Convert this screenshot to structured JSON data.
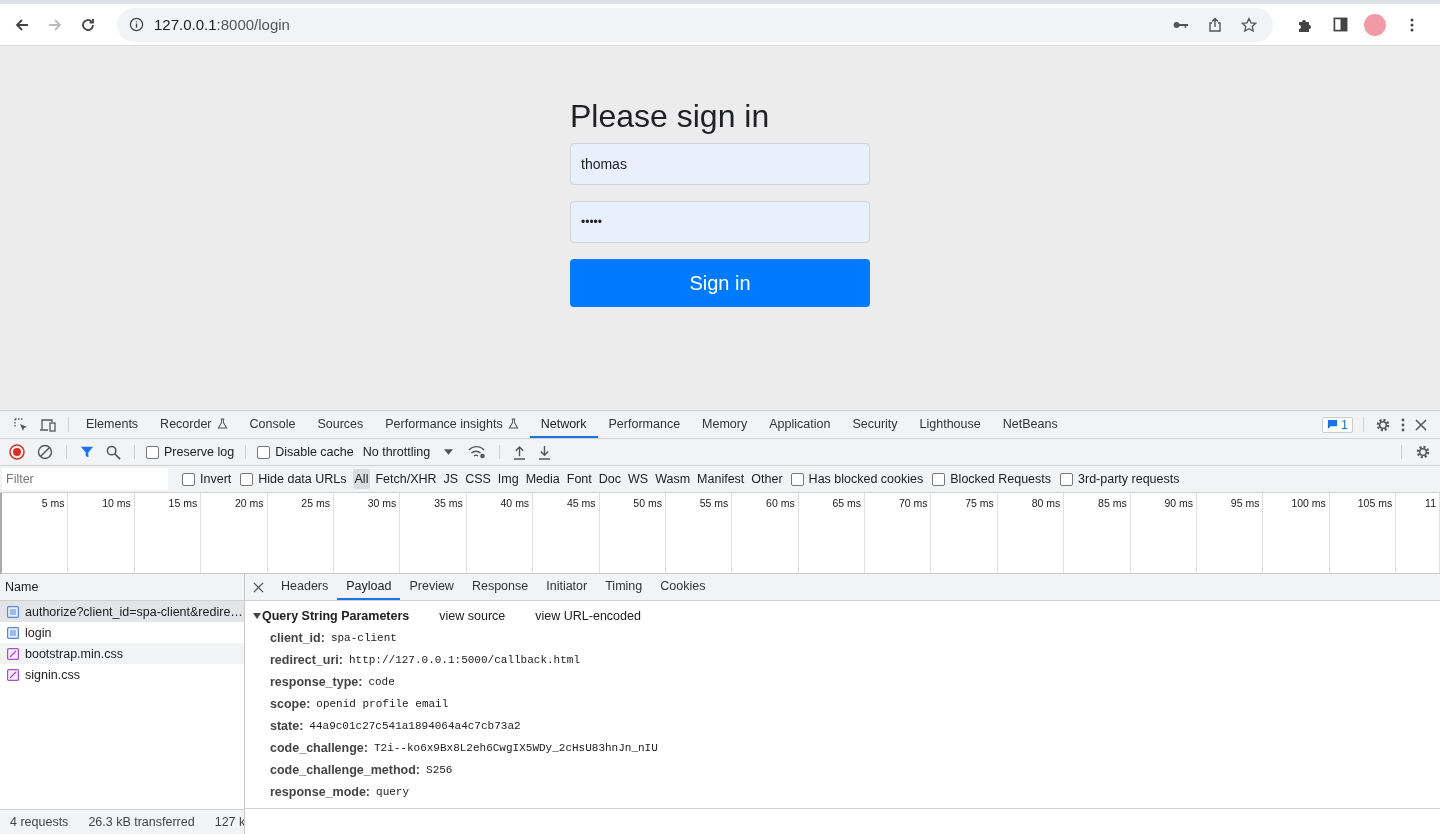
{
  "browser": {
    "navigation": [
      {
        "kind": "back",
        "disabled": false
      },
      {
        "kind": "forward",
        "disabled": true
      },
      {
        "kind": "reload",
        "disabled": false
      }
    ],
    "url_host": "127.0.0.1",
    "url_rest": ":8000/login"
  },
  "page": {
    "heading": "Please sign in",
    "username": "thomas",
    "password": "•••••",
    "button": "Sign in"
  },
  "devtools": {
    "tabs": [
      {
        "label": "Elements",
        "selected": false,
        "experimental": false
      },
      {
        "label": "Recorder",
        "selected": false,
        "experimental": true
      },
      {
        "label": "Console",
        "selected": false,
        "experimental": false
      },
      {
        "label": "Sources",
        "selected": false,
        "experimental": false
      },
      {
        "label": "Performance insights",
        "selected": false,
        "experimental": true
      },
      {
        "label": "Network",
        "selected": true,
        "experimental": false
      },
      {
        "label": "Performance",
        "selected": false,
        "experimental": false
      },
      {
        "label": "Memory",
        "selected": false,
        "experimental": false
      },
      {
        "label": "Application",
        "selected": false,
        "experimental": false
      },
      {
        "label": "Security",
        "selected": false,
        "experimental": false
      },
      {
        "label": "Lighthouse",
        "selected": false,
        "experimental": false
      },
      {
        "label": "NetBeans",
        "selected": false,
        "experimental": false
      }
    ],
    "issues_count": "1",
    "toolbar": {
      "recording": true,
      "preserve_log": {
        "label": "Preserve log",
        "checked": false
      },
      "disable_cache": {
        "label": "Disable cache",
        "checked": false
      },
      "throttling": "No throttling"
    },
    "filter": {
      "placeholder": "Filter",
      "options": [
        {
          "label": "Invert",
          "checked": false
        },
        {
          "label": "Hide data URLs",
          "checked": false
        }
      ],
      "types": [
        {
          "label": "All",
          "selected": true
        },
        {
          "label": "Fetch/XHR",
          "selected": false
        },
        {
          "label": "JS",
          "selected": false
        },
        {
          "label": "CSS",
          "selected": false
        },
        {
          "label": "Img",
          "selected": false
        },
        {
          "label": "Media",
          "selected": false
        },
        {
          "label": "Font",
          "selected": false
        },
        {
          "label": "Doc",
          "selected": false
        },
        {
          "label": "WS",
          "selected": false
        },
        {
          "label": "Wasm",
          "selected": false
        },
        {
          "label": "Manifest",
          "selected": false
        },
        {
          "label": "Other",
          "selected": false
        }
      ],
      "extra": [
        {
          "label": "Has blocked cookies",
          "checked": false
        },
        {
          "label": "Blocked Requests",
          "checked": false
        },
        {
          "label": "3rd-party requests",
          "checked": false
        }
      ]
    },
    "timeline_ticks": [
      "5 ms",
      "10 ms",
      "15 ms",
      "20 ms",
      "25 ms",
      "30 ms",
      "35 ms",
      "40 ms",
      "45 ms",
      "50 ms",
      "55 ms",
      "60 ms",
      "65 ms",
      "70 ms",
      "75 ms",
      "80 ms",
      "85 ms",
      "90 ms",
      "95 ms",
      "100 ms",
      "105 ms",
      "11"
    ],
    "requests_header": "Name",
    "requests": [
      {
        "name": "authorize?client_id=spa-client&redire…",
        "kind": "document",
        "selected": true,
        "hovered": false
      },
      {
        "name": "login",
        "kind": "document",
        "selected": false,
        "hovered": false
      },
      {
        "name": "bootstrap.min.css",
        "kind": "stylesheet",
        "selected": false,
        "hovered": true
      },
      {
        "name": "signin.css",
        "kind": "stylesheet",
        "selected": false,
        "hovered": false
      }
    ],
    "detail_tabs": [
      {
        "label": "Headers",
        "selected": false
      },
      {
        "label": "Payload",
        "selected": true
      },
      {
        "label": "Preview",
        "selected": false
      },
      {
        "label": "Response",
        "selected": false
      },
      {
        "label": "Initiator",
        "selected": false
      },
      {
        "label": "Timing",
        "selected": false
      },
      {
        "label": "Cookies",
        "selected": false
      }
    ],
    "payload": {
      "title": "Query String Parameters",
      "expanded": true,
      "links": [
        "view source",
        "view URL-encoded"
      ],
      "params": [
        {
          "key": "client_id:",
          "value": "spa-client"
        },
        {
          "key": "redirect_uri:",
          "value": "http://127.0.0.1:5000/callback.html"
        },
        {
          "key": "response_type:",
          "value": "code"
        },
        {
          "key": "scope:",
          "value": "openid profile email"
        },
        {
          "key": "state:",
          "value": "44a9c01c27c541a1894064a4c7cb73a2"
        },
        {
          "key": "code_challenge:",
          "value": "T2i--ko6x9Bx8L2eh6CwgIX5WDy_2cHsU83hnJn_nIU"
        },
        {
          "key": "code_challenge_method:",
          "value": "S256"
        },
        {
          "key": "response_mode:",
          "value": "query"
        }
      ]
    },
    "status": [
      "4 requests",
      "26.3 kB transferred",
      "127 k"
    ]
  }
}
